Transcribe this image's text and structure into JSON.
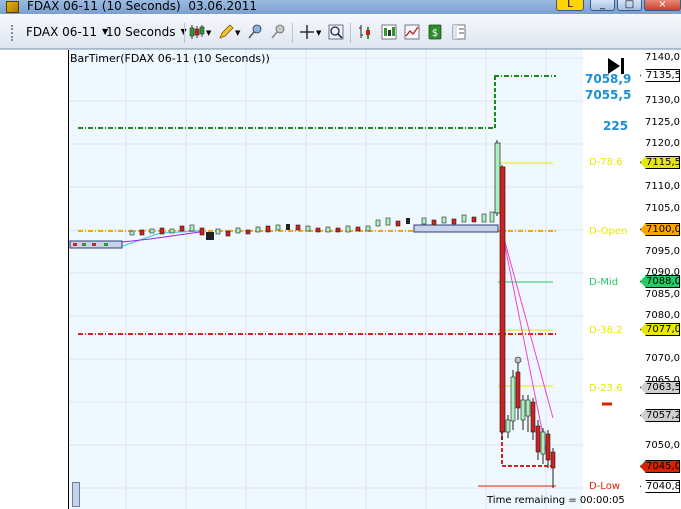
{
  "window": {
    "title": "FDAX 06-11 (10 Seconds)  03.06.2011",
    "btn_l": "L",
    "btn_min": "_",
    "btn_max": "□",
    "btn_close": "×"
  },
  "toolbar": {
    "instrument": "FDAX 06-11",
    "interval": "10 Seconds",
    "icons": [
      "candlestick-icon",
      "pencil-icon",
      "pin-icon",
      "pin-gray-icon",
      "crosshair-icon",
      "zoom-icon",
      "bar-chart-icon",
      "data-box-icon",
      "chart-style-icon",
      "dollar-icon",
      "properties-icon"
    ]
  },
  "chart": {
    "indicator": "BarTimer(FDAX 06-11 (10 Seconds))",
    "time_remaining": "Time remaining = 00:00:05",
    "big_numbers": [
      "7058,9",
      "7055,5",
      "225"
    ],
    "levels": [
      {
        "label": "D-78.6",
        "color": "#e8e800"
      },
      {
        "label": "D-Open",
        "color": "#e8e800"
      },
      {
        "label": "D-Mid",
        "color": "#22cc66"
      },
      {
        "label": "D-38.2",
        "color": "#e8e800"
      },
      {
        "label": "D-23.6",
        "color": "#e8e800"
      },
      {
        "label": "D-Low",
        "color": "#dd2200"
      }
    ],
    "axis_ticks": [
      "7140,0",
      "7130,0",
      "7125,0",
      "7120,0",
      "7110,0",
      "7105,0",
      "7095,0",
      "7090,0",
      "7085,0",
      "7080,0",
      "7070,0",
      "7065,0",
      "7050,0"
    ],
    "price_tags": [
      {
        "value": "7135,5",
        "bg": "#ffffff"
      },
      {
        "value": "7115,5",
        "bg": "#e8e800"
      },
      {
        "value": "7100,0",
        "bg": "#ffa500"
      },
      {
        "value": "7088,0",
        "bg": "#22cc66"
      },
      {
        "value": "7077,0",
        "bg": "#e8e800"
      },
      {
        "value": "7063,5",
        "bg": "#cfcfcf"
      },
      {
        "value": "7057,2",
        "bg": "#cfcfcf"
      },
      {
        "value": "7045,0",
        "bg": "#dd2200"
      },
      {
        "value": "7040,8",
        "bg": "#ffffff"
      }
    ],
    "colors": {
      "high_line": "#1a8a1a",
      "low_line": "#dd2222",
      "open_line": "#ffa500",
      "up_candle": "#aaf0c0",
      "down_candle": "#d02020",
      "trend_line": "#ee44cc"
    }
  }
}
